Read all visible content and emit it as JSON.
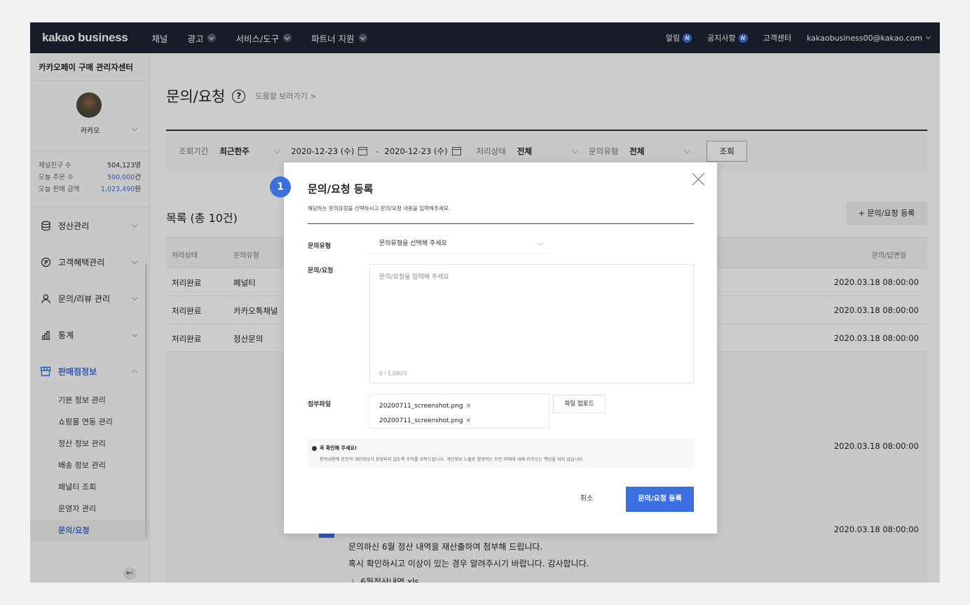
{
  "topnav": {
    "logo": "kakao business",
    "items": [
      {
        "label": "채널",
        "has_dropdown": false
      },
      {
        "label": "광고",
        "has_dropdown": true
      },
      {
        "label": "서비스/도구",
        "has_dropdown": true
      },
      {
        "label": "파트너 지원",
        "has_dropdown": true
      }
    ],
    "right": {
      "alarm": "알림",
      "notice": "공지사항",
      "badge": "N",
      "support": "고객센터",
      "email": "kakaobusiness00@kakao.com"
    }
  },
  "sidebar": {
    "title": "카카오페이 구매 관리자센터",
    "profile_name": "카카오",
    "stats": [
      {
        "label": "채널친구 수",
        "value": "504,123명",
        "highlight": ""
      },
      {
        "label": "오늘 주문 수",
        "value": "500,000",
        "unit": "건"
      },
      {
        "label": "오늘 판매 금액",
        "value": "1,023,490",
        "unit": "원"
      }
    ],
    "menu": [
      {
        "label": "정산관리",
        "icon": "database-icon"
      },
      {
        "label": "고객혜택관리",
        "icon": "coin-p-icon"
      },
      {
        "label": "문의/리뷰 관리",
        "icon": "person-icon"
      },
      {
        "label": "통계",
        "icon": "bar-chart-icon"
      },
      {
        "label": "판매점정보",
        "icon": "store-icon"
      }
    ],
    "submenu": [
      "기본 정보 관리",
      "쇼핑몰 연동 관리",
      "정산 정보 관리",
      "배송 정보 관리",
      "페널티 조회",
      "운영자 관리",
      "문의/요청"
    ],
    "collapse_icon": "arrow-left-icon"
  },
  "main": {
    "title": "문의/요청",
    "help_link": "도움말 보러가기 >",
    "filter": {
      "period_label": "조회기간",
      "period_value": "최근한주",
      "date_from": "2020-12-23 (수)",
      "date_to": "2020-12-23 (수)",
      "status_label": "처리상태",
      "status_value": "전체",
      "type_label": "문의유형",
      "type_value": "전체",
      "search_button": "조회"
    },
    "list_title": "목록 (총 10건)",
    "register_button": "+ 문의/요청 등록",
    "columns": {
      "status": "처리상태",
      "type": "문의유형",
      "date": "문의/답변일"
    },
    "rows": [
      {
        "status": "처리완료",
        "type": "페널티",
        "date": "2020.03.18 08:00:00"
      },
      {
        "status": "처리완료",
        "type": "카카오톡채널",
        "date": "2020.03.18 08:00:00"
      },
      {
        "status": "처리완료",
        "type": "정산문의",
        "date": "2020.03.18 08:00:00"
      }
    ],
    "extra_dates": [
      "2020.03.18 08:00:00",
      "2020.03.18 08:00:00"
    ],
    "reply_lines": [
      "문의하신 6월 정산 내역을 재산출하여 첨부해 드립니다.",
      "혹시 확인하시고 이상이 있는 경우 알려주시기 바랍니다. 감사합니다."
    ],
    "attachment": "6월정산내역.xls"
  },
  "modal": {
    "step": "1",
    "title": "문의/요청 등록",
    "subtitle": "해당하는 문의유형을 선택하시고 문의/요청 내용을 입력해주세요.",
    "type_label": "문의유형",
    "type_placeholder": "문의유형을 선택해 주세요",
    "content_label": "문의/요청",
    "content_placeholder": "문의/요청을 입력해 주세요",
    "char_count": "0 / 1,000자",
    "attach_label": "첨부파일",
    "files": [
      "20200711_screenshot.png",
      "20200711_screenshot.png"
    ],
    "file_remove": "×",
    "upload_button": "파일 업로드",
    "notice_title": "꼭 확인해 주세요!",
    "notice_desc": "문의내용에 본인의 개인정보가 포함되지 않도록 주의를 부탁드립니다. 개인정보 노출로 발생하는 모든 피해에 대해 카카오는 책임을 지지 않습니다.",
    "cancel_button": "취소",
    "submit_button": "문의/요청 등록"
  },
  "colors": {
    "nav_bg": "#1e2233",
    "accent": "#3a6fe0"
  }
}
